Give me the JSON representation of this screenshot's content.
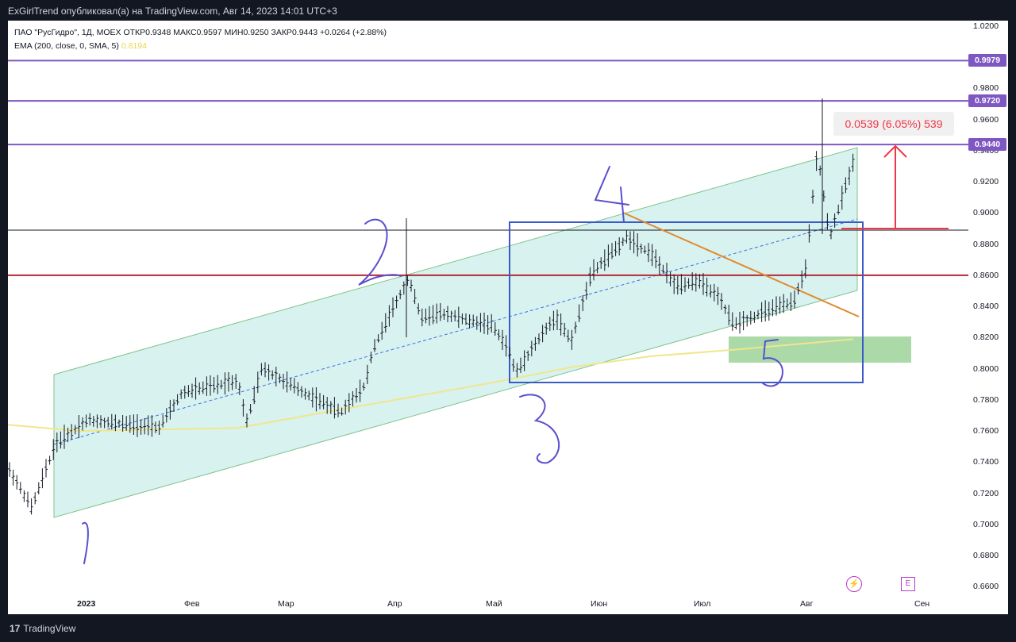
{
  "header": {
    "publish_line": "ExGirlTrend опубликовал(а) на TradingView.com, Авг 14, 2023 14:01 UTC+3"
  },
  "legend": {
    "line1": "ПАО \"РусГидро\", 1Д, MOEX  ОТКР0.9348  МАКС0.9597  МИН0.9250  ЗАКР0.9443  +0.0264 (+2.88%)",
    "line2_prefix": "EMA (200, close, 0, SMA, 5)",
    "line2_value": "0.8194"
  },
  "measure_label": "0.0539 (6.05%) 539",
  "price_tags": [
    "0.9979",
    "0.9720",
    "0.9440"
  ],
  "footer": {
    "brand": "TradingView",
    "brand_glyph": "17"
  },
  "icons": {
    "lightning": "lightning-icon",
    "earnings": "E"
  },
  "colors": {
    "background": "#131722",
    "channel_fill": "#d8f2f0",
    "channel_line": "#7fc48a",
    "purple_levels": "#7e57c2",
    "red_level": "#b22833",
    "ema": "#f0e68c",
    "blue_box": "#3a5bc7",
    "orange_trend": "#e08a2e",
    "green_zone": "#8fcc8b",
    "measure": "#f23645",
    "handwriting": "#5a4fcf"
  },
  "chart_data": {
    "type": "ohlc",
    "y_ticks": [
      "1.0200",
      "0.9800",
      "0.9600",
      "0.9400",
      "0.9200",
      "0.9000",
      "0.8800",
      "0.8600",
      "0.8400",
      "0.8200",
      "0.8000",
      "0.7800",
      "0.7600",
      "0.7400",
      "0.7200",
      "0.7000",
      "0.6800",
      "0.6600"
    ],
    "x_ticks": [
      "2023",
      "Фев",
      "Мар",
      "Апр",
      "Май",
      "Июн",
      "Июл",
      "Авг",
      "Сен"
    ],
    "ylim": [
      0.655,
      1.026
    ],
    "horizontal_levels": [
      {
        "price": 0.9979,
        "color": "purple"
      },
      {
        "price": 0.972,
        "color": "purple"
      },
      {
        "price": 0.944,
        "color": "purple"
      },
      {
        "price": 0.86,
        "color": "red"
      },
      {
        "price": 0.889,
        "color": "black"
      }
    ],
    "handwritten_labels": [
      "1",
      "2",
      "3",
      "4",
      "5"
    ],
    "ema_200": [
      0.764,
      0.76,
      0.761,
      0.762,
      0.773,
      0.782,
      0.791,
      0.801,
      0.808,
      0.812,
      0.819
    ]
  }
}
